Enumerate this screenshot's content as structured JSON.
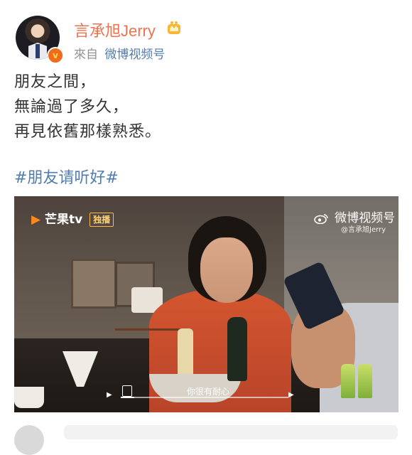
{
  "post": {
    "username": "言承旭Jerry",
    "source_prefix": "來自",
    "source_app": "微博视频号",
    "text_lines": [
      "朋友之間，",
      "無論過了多久，",
      "再見依舊那樣熟悉。"
    ],
    "hashtag": "#朋友请听好#",
    "avatar_badge": "v",
    "icons": [
      "crown-icon",
      "verified-badge-icon"
    ]
  },
  "video": {
    "channel_logo": "芒果tv",
    "channel_tag": "独播",
    "watermark_main": "微博视频号",
    "watermark_sub": "@言承旭Jerry",
    "subtitle": "你很有耐心",
    "progress": 0.08
  },
  "colors": {
    "username": "#eb7350",
    "link": "#507daf",
    "text": "#333333",
    "meta": "#939393"
  }
}
